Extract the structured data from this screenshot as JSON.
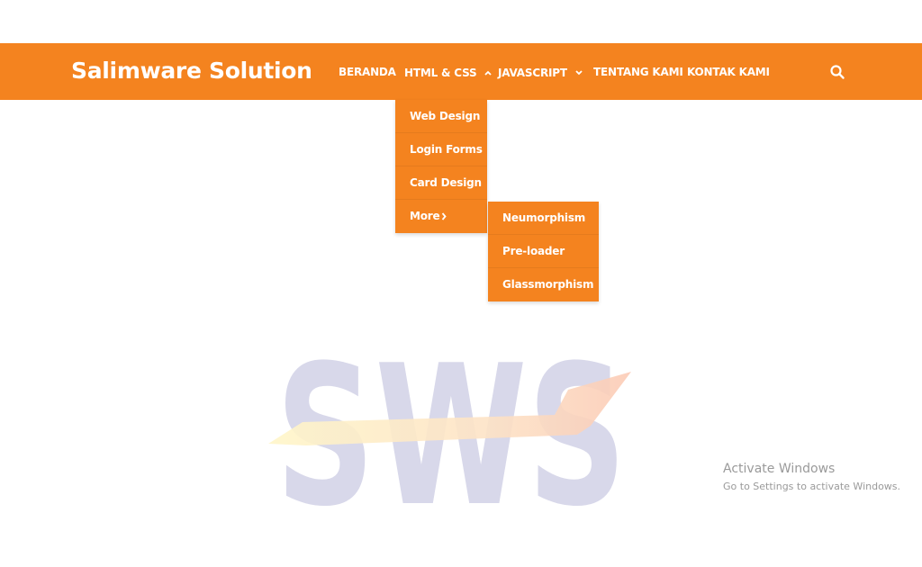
{
  "brand": "Salimware Solution",
  "nav": {
    "items": [
      {
        "label": "BERANDA"
      },
      {
        "label": "HTML & CSS"
      },
      {
        "label": "JAVASCRIPT"
      },
      {
        "label": "TENTANG KAMI"
      },
      {
        "label": "KONTAK KAMI"
      }
    ],
    "chevron_up": "˄",
    "chevron_down": "˅"
  },
  "dropdown": {
    "items": [
      "Web Design",
      "Login Forms",
      "Card Design",
      "More"
    ],
    "more_arrow": "›"
  },
  "submenu": {
    "items": [
      "Neumorphism",
      "Pre-loader",
      "Glassmorphism"
    ]
  },
  "logo": {
    "text": "SWS",
    "color": "#d8d8ea"
  },
  "watermark": {
    "title": "Activate Windows",
    "subtitle": "Go to Settings to activate Windows."
  },
  "colors": {
    "accent": "#f4831f",
    "text_on_accent": "#ffffff"
  }
}
